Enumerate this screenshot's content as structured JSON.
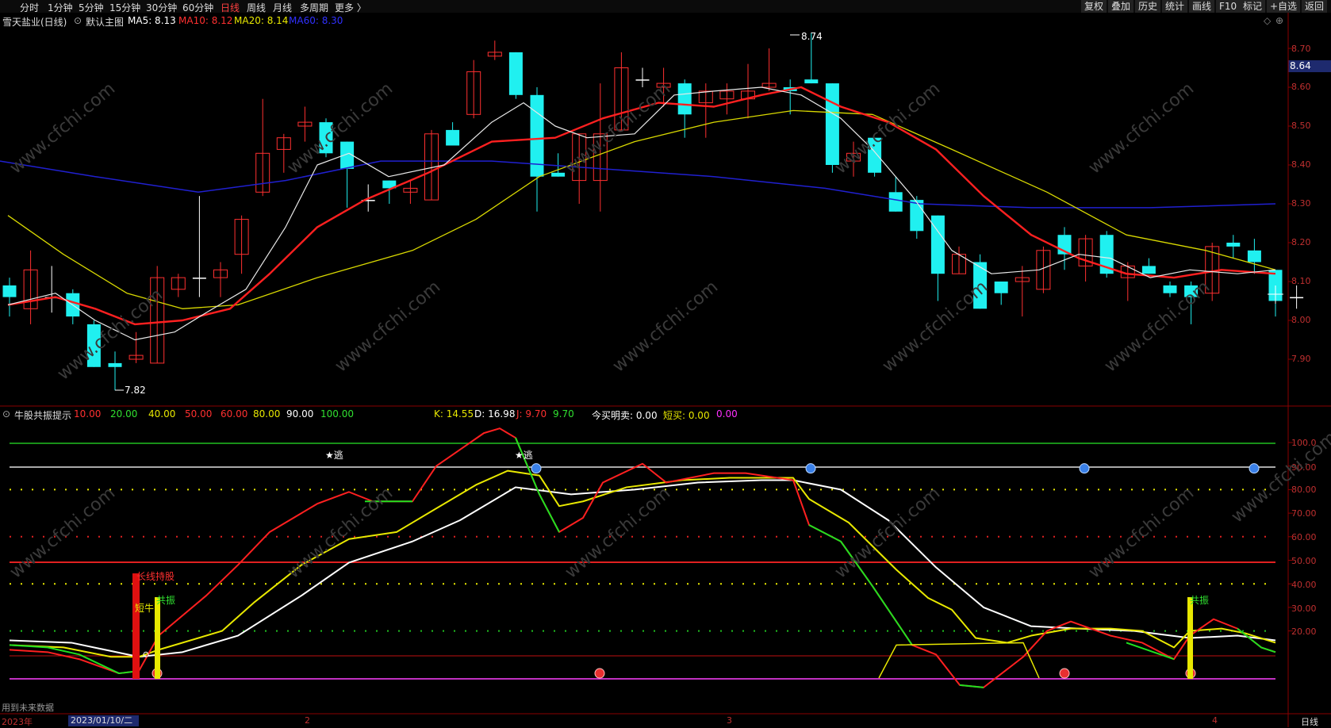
{
  "toolbar": {
    "tabs": [
      "分时",
      "1分钟",
      "5分钟",
      "15分钟",
      "30分钟",
      "60分钟",
      "日线",
      "周线",
      "月线",
      "多周期",
      "更多 〉"
    ],
    "active": "日线",
    "right": [
      "复权",
      "叠加",
      "历史",
      "统计",
      "画线",
      "F10",
      "标记",
      "+自选",
      "返回"
    ]
  },
  "main": {
    "stock": "雪天盐业(日线)",
    "template": "默认主图",
    "ma": [
      {
        "label": "MA5: 8.13",
        "color": "#ffffff"
      },
      {
        "label": "MA10: 8.12",
        "color": "#ff3030"
      },
      {
        "label": "MA20: 8.14",
        "color": "#e8e800"
      },
      {
        "label": "MA60: 8.30",
        "color": "#3030ff"
      }
    ],
    "high_label": "8.74",
    "low_label": "7.82",
    "price_tag": "8.64",
    "price_axis": [
      "8.70",
      "8.60",
      "8.50",
      "8.40",
      "8.30",
      "8.20",
      "8.10",
      "8.00",
      "7.90"
    ]
  },
  "indicator": {
    "name": "牛股共振提示",
    "levels": [
      {
        "label": "10.00",
        "color": "#ff3030"
      },
      {
        "label": "20.00",
        "color": "#30e030"
      },
      {
        "label": "40.00",
        "color": "#e8e800"
      },
      {
        "label": "50.00",
        "color": "#ff3030"
      },
      {
        "label": "60.00",
        "color": "#ff3030"
      },
      {
        "label": "80.00",
        "color": "#e8e800"
      },
      {
        "label": "90.00",
        "color": "#ffffff"
      },
      {
        "label": "100.00",
        "color": "#30e030"
      }
    ],
    "kdj": [
      {
        "label": "K: 14.55",
        "color": "#e8e800"
      },
      {
        "label": "D: 16.98",
        "color": "#ffffff"
      },
      {
        "label": "J: 9.70",
        "color": "#ff3030"
      },
      {
        "label": "9.70",
        "color": "#30e030"
      }
    ],
    "extra": [
      {
        "label": "今买明卖: 0.00",
        "color": "#ffffff"
      },
      {
        "label": "短买: 0.00",
        "color": "#e8e800"
      },
      {
        "label": "0.00",
        "color": "#ff30ff"
      }
    ],
    "axis": [
      "100.0",
      "90.00",
      "80.00",
      "70.00",
      "60.00",
      "50.00",
      "40.00",
      "30.00",
      "20.00"
    ],
    "annotations": {
      "escape1": "★逃",
      "escape2": "★逃",
      "hold": "长线持股",
      "short": "短牛",
      "resonance1": "共振",
      "resonance2": "共振"
    }
  },
  "footer": {
    "note": "用到未来数据",
    "year": "2023年",
    "date": "2023/01/10/二",
    "months": [
      "2",
      "3",
      "4"
    ],
    "period": "日线"
  }
}
